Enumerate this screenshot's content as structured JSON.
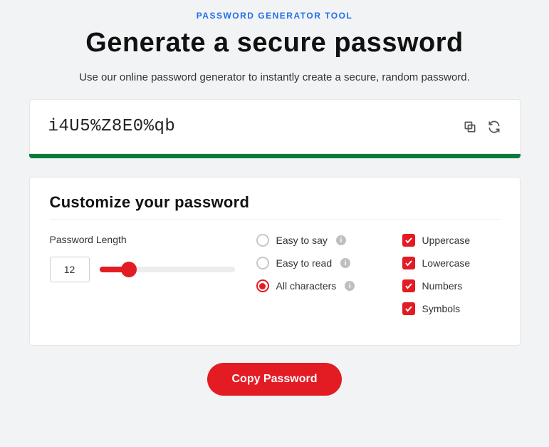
{
  "header": {
    "eyebrow": "PASSWORD GENERATOR TOOL",
    "title": "Generate a secure password",
    "subtitle": "Use our online password generator to instantly create a secure, random password."
  },
  "password": {
    "value": "i4U5%Z8E0%qb",
    "strength_color": "#0b7a3b"
  },
  "customize": {
    "heading": "Customize your password",
    "length_label": "Password Length",
    "length_value": "12",
    "modes": {
      "easy_say": "Easy to say",
      "easy_read": "Easy to read",
      "all_chars": "All characters",
      "selected": "all_chars"
    },
    "char_options": {
      "uppercase": "Uppercase",
      "lowercase": "Lowercase",
      "numbers": "Numbers",
      "symbols": "Symbols"
    }
  },
  "actions": {
    "copy_button": "Copy Password"
  }
}
